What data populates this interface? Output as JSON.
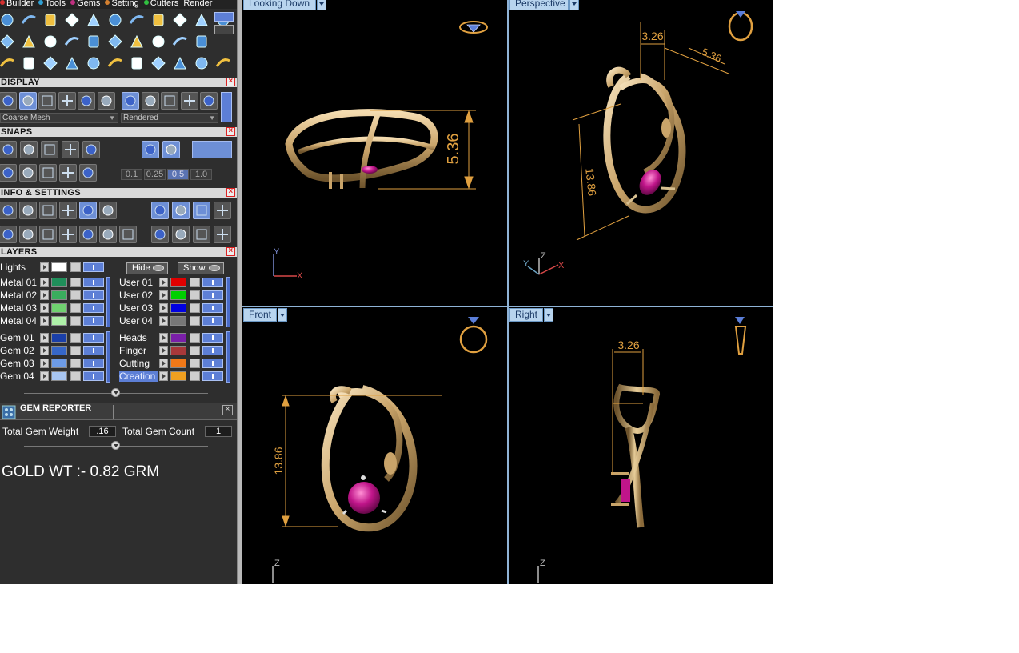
{
  "menu": [
    "Builder",
    "Tools",
    "Gems",
    "Setting",
    "Cutters",
    "Render"
  ],
  "menu_dot_colors": [
    "#d43030",
    "#30a0d4",
    "#c03080",
    "#d48030",
    "#30c040"
  ],
  "toolbar_icons": [
    [
      "curve-icon",
      "pen-icon",
      "lock-shape-icon",
      "lock-shape-icon-2",
      "lock-shape-icon-3",
      "gem-cluster-icon",
      "leaf-icon",
      "gem-set-icon",
      "pipe-icon",
      "wheel-icon",
      "view-icon"
    ],
    [
      "surface-icon",
      "gem-icon",
      "plane-icon",
      "blade-icon",
      "panel-icon",
      "twist-icon",
      "bend-icon",
      "gear-icon",
      "pattern-icon",
      "flower-icon"
    ],
    [
      "group-icon",
      "arc-icon",
      "rotate-icon",
      "mirror-icon",
      "move-icon",
      "scale-icon",
      "sweep-icon",
      "link-icon",
      "mirror-copy-icon",
      "boolean-icon",
      "ring-icon"
    ]
  ],
  "display": {
    "title": "DISPLAY",
    "mesh_select": "Coarse Mesh",
    "render_select": "Rendered"
  },
  "snaps": {
    "title": "SNAPS",
    "values": [
      "0.1",
      "0.25",
      "0.5",
      "1.0"
    ],
    "active": "0.5"
  },
  "info": {
    "title": "INFO & SETTINGS"
  },
  "layers": {
    "title": "LAYERS",
    "lights_label": "Lights",
    "hide_label": "Hide",
    "show_label": "Show",
    "left": [
      {
        "name": "Metal 01",
        "color": "#1f8f5a"
      },
      {
        "name": "Metal 02",
        "color": "#39ad5d"
      },
      {
        "name": "Metal 03",
        "color": "#6fd16f"
      },
      {
        "name": "Metal 04",
        "color": "#aef0a8"
      },
      {
        "name": "Gem 01",
        "color": "#1a3fa8"
      },
      {
        "name": "Gem 02",
        "color": "#3667c8"
      },
      {
        "name": "Gem 03",
        "color": "#6d9be6"
      },
      {
        "name": "Gem 04",
        "color": "#a8c6f2"
      }
    ],
    "right": [
      {
        "name": "User 01",
        "color": "#e00000"
      },
      {
        "name": "User 02",
        "color": "#00d000"
      },
      {
        "name": "User 03",
        "color": "#0000e0"
      },
      {
        "name": "User 04",
        "color": "#777777"
      },
      {
        "name": "Heads",
        "color": "#7a1fa8"
      },
      {
        "name": "Finger",
        "color": "#a8383a"
      },
      {
        "name": "Cutting",
        "color": "#f07818"
      },
      {
        "name": "Creation",
        "color": "#f0a020"
      }
    ]
  },
  "gem_reporter": {
    "title": "GEM REPORTER",
    "weight_label": "Total Gem Weight",
    "weight_value": ".16",
    "count_label": "Total Gem Count",
    "count_value": "1"
  },
  "gold_text": "GOLD WT :- 0.82 GRM",
  "viewports": {
    "top": {
      "label": "Looking Down",
      "dimension": "5.36",
      "axis_1": "Y",
      "axis_2": "X"
    },
    "perspective": {
      "label": "Perspective",
      "dim_a": "3.26",
      "dim_b": "5.36",
      "dim_c": "13.86",
      "axis_1": "Y",
      "axis_2": "Z",
      "axis_3": "X"
    },
    "front": {
      "label": "Front",
      "dimension": "13.86",
      "axis_1": "Z"
    },
    "right": {
      "label": "Right",
      "dimension": "3.26",
      "axis_1": "Z"
    }
  },
  "colors": {
    "gold": "#d3b07c",
    "gold_dark": "#8a6a3a",
    "gem": "#c0158a",
    "dimension": "#e0a040",
    "axis": "#7a8ad0",
    "axis_x": "#d84848"
  }
}
